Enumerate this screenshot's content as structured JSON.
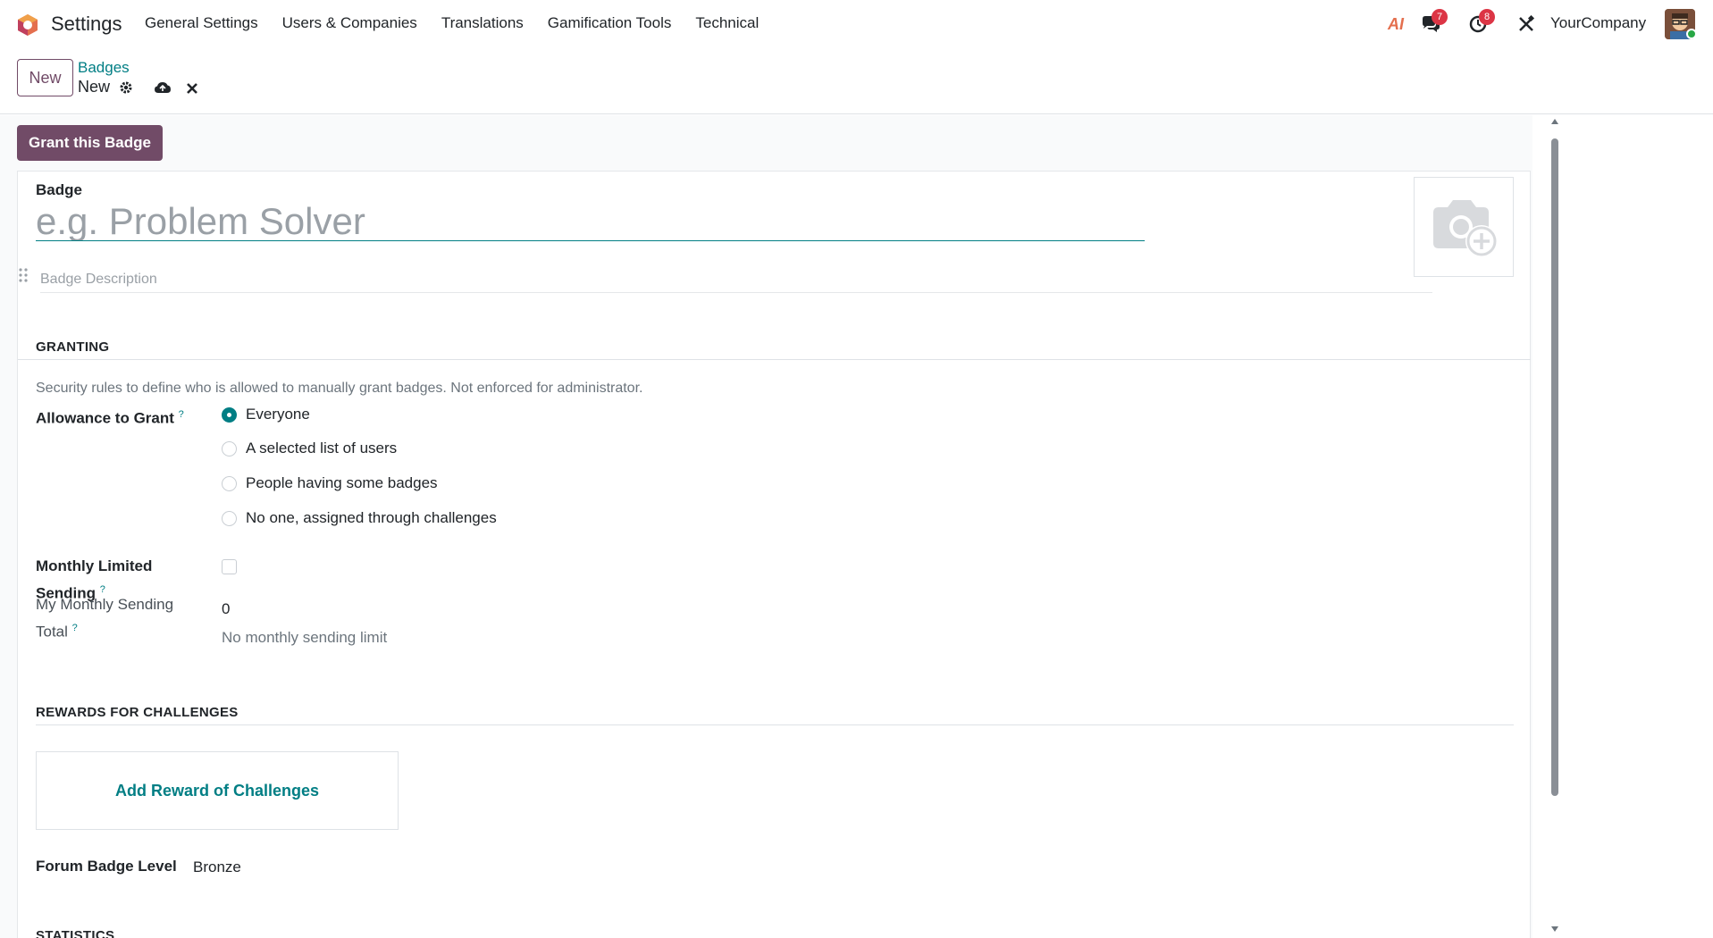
{
  "navbar": {
    "app_name": "Settings",
    "menu": [
      "General Settings",
      "Users & Companies",
      "Translations",
      "Gamification Tools",
      "Technical"
    ],
    "ai_label": "AI",
    "messages_count": "7",
    "activities_count": "8",
    "company": "YourCompany"
  },
  "control_panel": {
    "new_label": "New",
    "breadcrumb_parent": "Badges",
    "breadcrumb_current": "New"
  },
  "statusbar": {
    "grant_label": "Grant this Badge"
  },
  "form": {
    "badge_label": "Badge",
    "name_placeholder": "e.g. Problem Solver",
    "description_placeholder": "Badge Description",
    "granting": {
      "title": "GRANTING",
      "help": "Security rules to define who is allowed to manually grant badges. Not enforced for administrator.",
      "allowance_label": "Allowance to Grant",
      "options": [
        "Everyone",
        "A selected list of users",
        "People having some badges",
        "No one, assigned through challenges"
      ],
      "selected": "Everyone",
      "monthly_limited_label_1": "Monthly Limited",
      "monthly_limited_label_2": "Sending",
      "monthly_total_label_1": "My Monthly Sending",
      "monthly_total_label_2": "Total",
      "monthly_total_value": "0",
      "monthly_total_note": "No monthly sending limit"
    },
    "rewards": {
      "title": "REWARDS FOR CHALLENGES",
      "add_label": "Add Reward of Challenges",
      "forum_level_label": "Forum Badge Level",
      "forum_level_value": "Bronze"
    },
    "statistics": {
      "title": "STATISTICS"
    }
  },
  "help_mark": "?",
  "colors": {
    "brand": "#714B67",
    "accent": "#017e84",
    "badge": "#dc3545"
  }
}
